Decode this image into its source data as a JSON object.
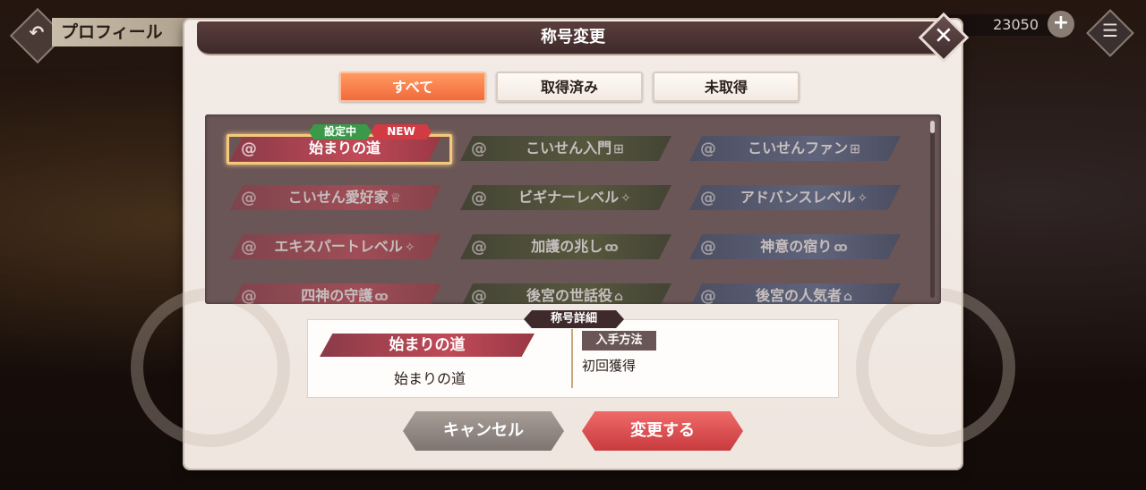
{
  "header": {
    "back_glyph": "↶",
    "title": "プロフィール",
    "currency": "23050",
    "plus_glyph": "+",
    "menu_glyph": "☰"
  },
  "dialog": {
    "title": "称号変更",
    "close_glyph": "✕",
    "tabs": [
      {
        "label": "すべて",
        "active": true
      },
      {
        "label": "取得済み",
        "active": false
      },
      {
        "label": "未取得",
        "active": false
      }
    ],
    "badges": {
      "current": "設定中",
      "new": "NEW"
    },
    "titles": [
      {
        "label": "始まりの道",
        "color": "red",
        "symbol": "",
        "obtained": true,
        "selected": true
      },
      {
        "label": "こいせん入門",
        "color": "green",
        "symbol": "⊞",
        "obtained": false
      },
      {
        "label": "こいせんファン",
        "color": "blue",
        "symbol": "⊞",
        "obtained": false
      },
      {
        "label": "こいせん愛好家",
        "color": "red",
        "symbol": "♕",
        "obtained": false
      },
      {
        "label": "ビギナーレベル",
        "color": "green",
        "symbol": "✧",
        "obtained": false
      },
      {
        "label": "アドバンスレベル",
        "color": "blue",
        "symbol": "✧",
        "obtained": false
      },
      {
        "label": "エキスパートレベル",
        "color": "red",
        "symbol": "✧",
        "obtained": false
      },
      {
        "label": "加護の兆し",
        "color": "green",
        "symbol": "ꝏ",
        "obtained": false
      },
      {
        "label": "神意の宿り",
        "color": "blue",
        "symbol": "ꝏ",
        "obtained": false
      },
      {
        "label": "四神の守護",
        "color": "red",
        "symbol": "ꝏ",
        "obtained": false
      },
      {
        "label": "後宮の世話役",
        "color": "green",
        "symbol": "⌂",
        "obtained": false
      },
      {
        "label": "後宮の人気者",
        "color": "blue",
        "symbol": "⌂",
        "obtained": false
      }
    ],
    "detail": {
      "header": "称号詳細",
      "title_ribbon": "始まりの道",
      "title_name": "始まりの道",
      "method_label": "入手方法",
      "method_value": "初回獲得"
    },
    "buttons": {
      "cancel": "キャンセル",
      "change": "変更する"
    }
  }
}
